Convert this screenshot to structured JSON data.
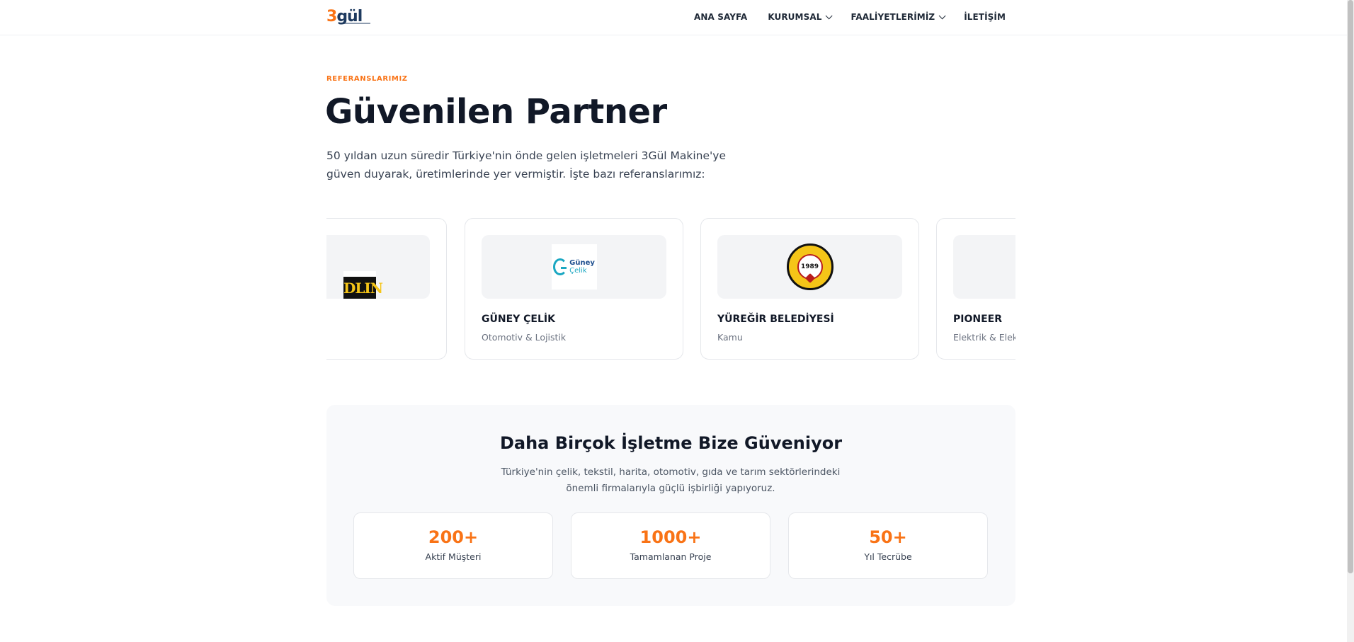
{
  "header": {
    "logo": {
      "digit": "3",
      "word": "gül"
    },
    "nav": [
      {
        "label": "ANA SAYFA",
        "dropdown": false
      },
      {
        "label": "KURUMSAL",
        "dropdown": true
      },
      {
        "label": "FAALİYETLERİMİZ",
        "dropdown": true
      },
      {
        "label": "İLETİŞİM",
        "dropdown": false
      }
    ]
  },
  "hero": {
    "eyebrow": "REFERANSLARIMIZ",
    "title": "Güvenilen Partner",
    "description": "50 yıldan uzun süredir Türkiye'nin önde gelen işletmeleri 3Gül Makine'ye güven duyarak, üretimlerinde yer vermiştir. İşte bazı referanslarımız:"
  },
  "references": [
    {
      "name": "",
      "sector": "",
      "logo_text": "DLIN"
    },
    {
      "name": "GÜNEY ÇELİK",
      "sector": "Otomotiv & Lojistik",
      "logo_text": "Güney",
      "logo_text2": "Çelik"
    },
    {
      "name": "YÜREĞİR BELEDİYESİ",
      "sector": "Kamu",
      "logo_text": "1989"
    },
    {
      "name": "PIONEER",
      "sector": "Elektrik & Elektronik"
    }
  ],
  "trust": {
    "title": "Daha Birçok İşletme Bize Güveniyor",
    "description": "Türkiye'nin çelik, tekstil, harita, otomotiv, gıda ve tarım sektörlerindeki önemli firmalarıyla güçlü işbirliği yapıyoruz.",
    "stats": [
      {
        "value": "200+",
        "label": "Aktif Müşteri"
      },
      {
        "value": "1000+",
        "label": "Tamamlanan Proje"
      },
      {
        "value": "50+",
        "label": "Yıl Tecrübe"
      }
    ]
  },
  "colors": {
    "accent": "#f97316",
    "text": "#111827",
    "muted": "#6b7280",
    "card_bg": "#f3f4f6"
  }
}
